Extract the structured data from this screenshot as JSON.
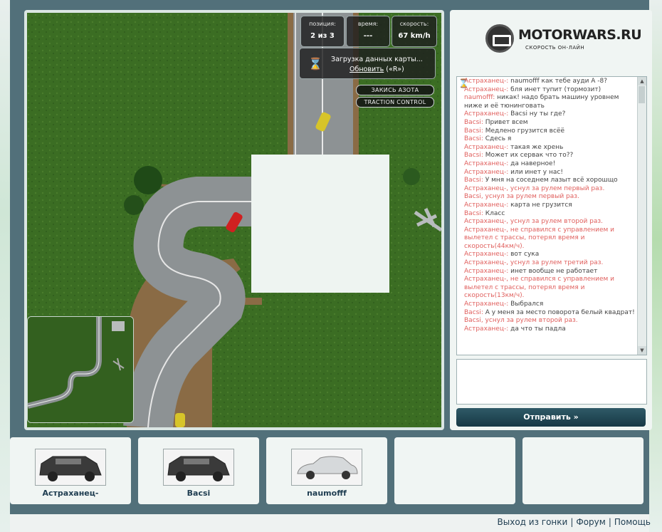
{
  "hud": {
    "position_label": "позиция:",
    "position_value": "2 из 3",
    "time_label": "время:",
    "time_value": "---",
    "speed_label": "скорость:",
    "speed_value": "67 km/h"
  },
  "loading": {
    "text": "Загрузка данных карты...",
    "refresh_link": "Обновить",
    "refresh_hint": "(«R»)"
  },
  "buttons": {
    "nitro": "ЗАКИСЬ АЗОТА",
    "traction": "TRACTION CONTROL",
    "send": "Отправить »"
  },
  "logo": {
    "name": "MOTORWARS.RU",
    "subtitle": "СКОРОСТЬ ОН-ЛАЙН"
  },
  "chat": {
    "messages": [
      {
        "nick": "Астраханец-:",
        "text": " naumofff как тебе ауди А -8?",
        "kind": "msg"
      },
      {
        "nick": "Астраханец-:",
        "text": " бля инет тупит (тормозит)",
        "kind": "msg"
      },
      {
        "nick": "naumofff:",
        "text": " никак! надо брать машину уровнем ниже и её тюнинговать",
        "kind": "msg"
      },
      {
        "nick": "Астраханец-:",
        "text": " Bacsi ну ты где?",
        "kind": "msg"
      },
      {
        "nick": "Bacsi:",
        "text": " Привет всем",
        "kind": "msg"
      },
      {
        "nick": "Bacsi:",
        "text": " Медлено грузится всёё",
        "kind": "msg"
      },
      {
        "nick": "Bacsi:",
        "text": " Сдесь я",
        "kind": "msg"
      },
      {
        "nick": "Астраханец-:",
        "text": " такая же хрень",
        "kind": "msg"
      },
      {
        "nick": "Bacsi:",
        "text": " Может их сервак что то??",
        "kind": "msg"
      },
      {
        "nick": "Астраханец-:",
        "text": " да наверное!",
        "kind": "msg"
      },
      {
        "nick": "Астраханец-:",
        "text": " или инет у нас!",
        "kind": "msg"
      },
      {
        "nick": "Bacsi:",
        "text": " У мня на соседнем лазыт всё хорошщо",
        "kind": "msg"
      },
      {
        "nick": "",
        "text": "Астраханец-, уснул за рулем первый раз.",
        "kind": "sys"
      },
      {
        "nick": "",
        "text": "Bacsi, уснул за рулем первый раз.",
        "kind": "sys"
      },
      {
        "nick": "Астраханец-:",
        "text": " карта не грузится",
        "kind": "msg"
      },
      {
        "nick": "Bacsi:",
        "text": " Класс",
        "kind": "msg"
      },
      {
        "nick": "",
        "text": "Астраханец-, уснул за рулем второй раз.",
        "kind": "sys"
      },
      {
        "nick": "",
        "text": "Астраханец-, не справился с управлением и вылетел с трассы, потерял время и скорость(44км/ч).",
        "kind": "sys"
      },
      {
        "nick": "Астраханец-:",
        "text": " вот сука",
        "kind": "msg"
      },
      {
        "nick": "",
        "text": "Астраханец-, уснул за рулем третий раз.",
        "kind": "sys"
      },
      {
        "nick": "Астраханец-:",
        "text": " инет вообще не работает",
        "kind": "msg"
      },
      {
        "nick": "",
        "text": "Астраханец-, не справился с управлением и вылетел с трассы, потерял время и скорость(13км/ч).",
        "kind": "sys"
      },
      {
        "nick": "Астраханец-:",
        "text": " Выбрался",
        "kind": "msg"
      },
      {
        "nick": "Bacsi:",
        "text": " А у меня за место поворота белый квадрат!",
        "kind": "msg"
      },
      {
        "nick": "",
        "text": "Bacsi, уснул за рулем второй раз.",
        "kind": "sys"
      },
      {
        "nick": "Астраханец-:",
        "text": " да что ты падла",
        "kind": "msg"
      }
    ],
    "input_value": ""
  },
  "players": [
    {
      "name": "Астраханец-",
      "car": "dark-suv"
    },
    {
      "name": "Bacsi",
      "car": "dark-suv"
    },
    {
      "name": "naumofff",
      "car": "silver-sedan"
    },
    {
      "name": "",
      "car": ""
    },
    {
      "name": "",
      "car": ""
    }
  ],
  "footer": {
    "exit": "Выход из гонки",
    "forum": "Форум",
    "help": "Помощь"
  },
  "colors": {
    "frame": "#52707a",
    "panel": "#f0f5f3",
    "chat_highlight": "#e0605e",
    "button_dark": "#1f4350"
  },
  "icons": [
    "hourglass-icon",
    "logo-mark-icon",
    "scroll-up-icon",
    "scroll-down-icon"
  ]
}
